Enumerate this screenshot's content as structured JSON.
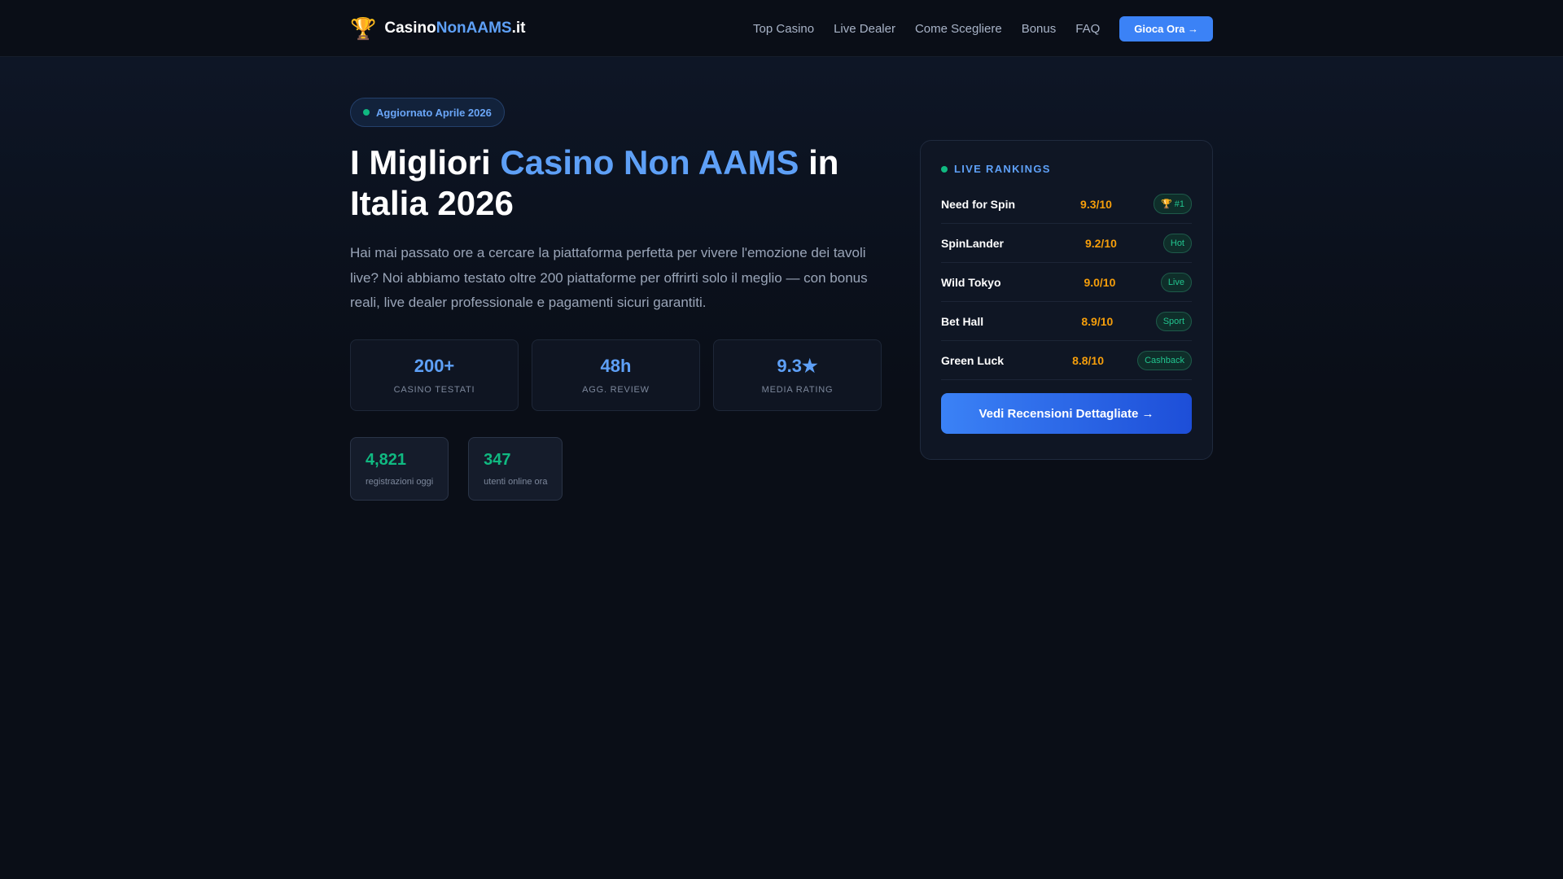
{
  "header": {
    "logo_icon": "🏆",
    "logo_part1": "Casino",
    "logo_part2": "NonAAMS",
    "logo_part3": ".it",
    "nav": [
      "Top Casino",
      "Live Dealer",
      "Come Scegliere",
      "Bonus",
      "FAQ"
    ],
    "cta": "Gioca Ora →"
  },
  "hero": {
    "badge": "Aggiornato Aprile 2026",
    "title_part1": "I Migliori ",
    "title_highlight": "Casino Non AAMS",
    "title_part2": " in Italia 2026",
    "intro": "Hai mai passato ore a cercare la piattaforma perfetta per vivere l'emozione dei tavoli live? Noi abbiamo testato oltre 200 piattaforme per offrirti solo il meglio — con bonus reali, live dealer professionale e pagamenti sicuri garantiti.",
    "stats": [
      {
        "value": "200+",
        "label": "CASINO TESTATI"
      },
      {
        "value": "48h",
        "label": "AGG. REVIEW"
      },
      {
        "value": "9.3★",
        "label": "MEDIA RATING"
      }
    ],
    "live_stats": [
      {
        "value": "4,821",
        "label": "registrazioni oggi"
      },
      {
        "value": "347",
        "label": "utenti online ora"
      }
    ]
  },
  "rankings": {
    "title": "LIVE RANKINGS",
    "items": [
      {
        "name": "Need for Spin",
        "score": "9.3/10",
        "tag": "🏆 #1"
      },
      {
        "name": "SpinLander",
        "score": "9.2/10",
        "tag": "Hot"
      },
      {
        "name": "Wild Tokyo",
        "score": "9.0/10",
        "tag": "Live"
      },
      {
        "name": "Bet Hall",
        "score": "8.9/10",
        "tag": "Sport"
      },
      {
        "name": "Green Luck",
        "score": "8.8/10",
        "tag": "Cashback"
      }
    ],
    "button": "Vedi Recensioni Dettagliate →"
  },
  "colors": {
    "background": "#0a0e17",
    "accent_blue": "#3b82f6",
    "highlight_blue": "#5ea0f7",
    "score_orange": "#f59e0b",
    "status_green": "#10b981"
  }
}
